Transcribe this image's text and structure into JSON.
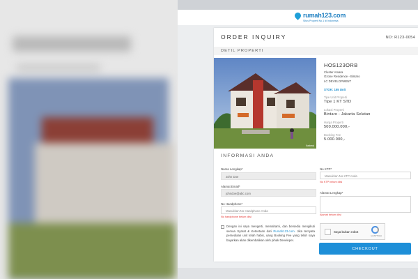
{
  "header": {
    "logo_text": "rumah123.com",
    "logo_tagline": "Situs Properti No.1 di Indonesia"
  },
  "page": {
    "title": "ORDER INQUIRY",
    "order_no": "NO: R123-0054",
    "section_detil": "DETIL PROPERTI",
    "section_info": "INFORMASI ANDA"
  },
  "property": {
    "code": "HOS123ORB",
    "cluster": "Cluster Amara",
    "residence": "Ozone Residence - Bintaro",
    "developer": "LC DEVELOPMENT",
    "stok": "STOK: 155 Unit",
    "photo_caption": "Ilustrasi",
    "tipe_label": "Tipe Unit Properti",
    "tipe_value": "Tipe 1 KT STD",
    "lokasi_label": "Lokasi Properti",
    "lokasi_value": "Bintaro - Jakarta Selatan",
    "harga_label": "Harga Properti",
    "harga_value": "500.000.000,-",
    "booking_label": "Booking Fee",
    "booking_value": "5.000.000,-"
  },
  "form": {
    "nama_label": "Nama Lengkap*",
    "nama_value": "John Doe",
    "ktp_label": "No KTP*",
    "ktp_placeholder": "Masukkan No KTP Anda",
    "ktp_error": "No KTP belum diisi",
    "email_label": "Alamat Email*",
    "email_value": "johndoe@abc.com",
    "alamat_label": "Alamat Lengkap*",
    "alamat_error": "Alamat belum diisi",
    "hp_label": "No Handphone*",
    "hp_placeholder": "Masukkan No Handphone Anda",
    "hp_error": "No handphone belum diisi",
    "agree_text_1": "Dengan ini saya mengerti, memahami, dan bersedia mengikuti semua Syarat & Ketentuan dari ",
    "agree_link": "Rumah123.com",
    "agree_text_2": ". Jika ternyata persediaan unit telah habis, uang Booking Fee yang telah saya bayarkan akan dikembalikan oleh pihak Developer.",
    "captcha_label": "Saya bukan robot",
    "captcha_brand": "reCAPTCHA",
    "checkout_label": "CHECKOUT"
  }
}
